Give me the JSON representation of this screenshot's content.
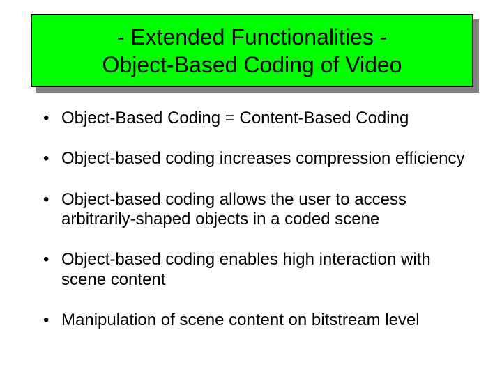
{
  "title": {
    "line1": "- Extended Functionalities -",
    "line2": "Object-Based Coding of Video"
  },
  "bullets": [
    "Object-Based Coding = Content-Based Coding",
    "Object-based coding increases compression efficiency",
    "Object-based coding allows the user to access arbitrarily-shaped objects in a coded scene",
    "Object-based coding enables high interaction with scene content",
    "Manipulation of scene content on bitstream level"
  ]
}
